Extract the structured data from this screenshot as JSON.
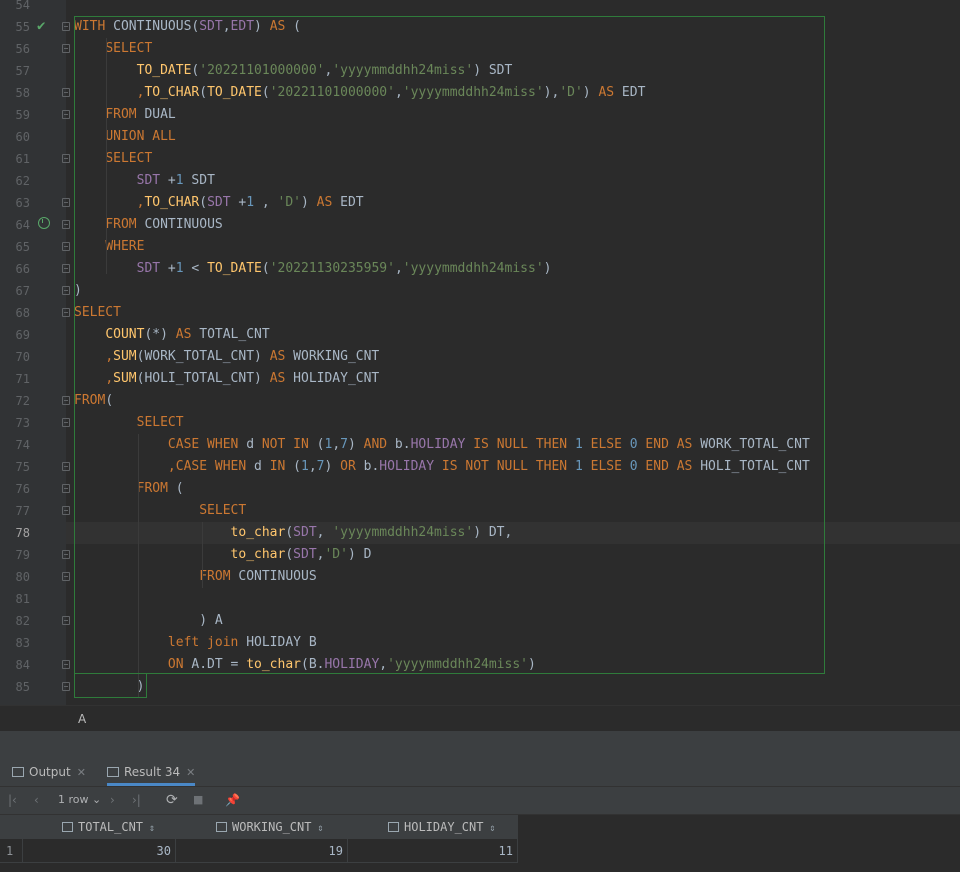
{
  "editor": {
    "current_line": "78",
    "lines": [
      {
        "n": "54",
        "html": ""
      },
      {
        "n": "55",
        "html": "<span class='kw'>WITH</span> CONTINUOUS(<span class='id'>SDT</span>,<span class='id'>EDT</span>) <span class='kw'>AS</span> ("
      },
      {
        "n": "56",
        "html": "    <span class='kw'>SELECT</span>"
      },
      {
        "n": "57",
        "html": "        <span class='fn'>TO_DATE</span>(<span class='str'>'20221101000000'</span>,<span class='str'>'yyyymmddhh24miss'</span>) SDT"
      },
      {
        "n": "58",
        "html": "        <span class='kw'>,</span><span class='fn'>TO_CHAR</span>(<span class='fn'>TO_DATE</span>(<span class='str'>'20221101000000'</span>,<span class='str'>'yyyymmddhh24miss'</span>),<span class='str'>'D'</span>) <span class='kw'>AS</span> EDT"
      },
      {
        "n": "59",
        "html": "    <span class='kw'>FROM</span> DUAL"
      },
      {
        "n": "60",
        "html": "    <span class='kw'>UNION ALL</span>"
      },
      {
        "n": "61",
        "html": "    <span class='kw'>SELECT</span>"
      },
      {
        "n": "62",
        "html": "        <span class='id'>SDT</span> +<span class='num'>1</span> SDT"
      },
      {
        "n": "63",
        "html": "        <span class='kw'>,</span><span class='fn'>TO_CHAR</span>(<span class='id'>SDT</span> +<span class='num'>1</span> , <span class='str'>'D'</span>) <span class='kw'>AS</span> EDT"
      },
      {
        "n": "64",
        "html": "    <span class='kw'>FROM</span> CONTINUOUS"
      },
      {
        "n": "65",
        "html": "    <span class='kw'>WHERE</span>"
      },
      {
        "n": "66",
        "html": "        <span class='id'>SDT</span> +<span class='num'>1</span> &lt; <span class='fn'>TO_DATE</span>(<span class='str'>'20221130235959'</span>,<span class='str'>'yyyymmddhh24miss'</span>)"
      },
      {
        "n": "67",
        "html": ")"
      },
      {
        "n": "68",
        "html": "<span class='kw'>SELECT</span>"
      },
      {
        "n": "69",
        "html": "    <span class='fn'>COUNT</span>(*) <span class='kw'>AS</span> TOTAL_CNT"
      },
      {
        "n": "70",
        "html": "    <span class='kw'>,</span><span class='fn'>SUM</span>(WORK_TOTAL_CNT) <span class='kw'>AS</span> WORKING_CNT"
      },
      {
        "n": "71",
        "html": "    <span class='kw'>,</span><span class='fn'>SUM</span>(HOLI_TOTAL_CNT) <span class='kw'>AS</span> HOLIDAY_CNT"
      },
      {
        "n": "72",
        "html": "<span class='kw'>FROM</span>("
      },
      {
        "n": "73",
        "html": "        <span class='kw'>SELECT</span>"
      },
      {
        "n": "74",
        "html": "            <span class='kw'>CASE WHEN</span> d <span class='kw'>NOT IN</span> (<span class='num'>1</span>,<span class='num'>7</span>) <span class='kw'>AND</span> b.<span class='id'>HOLIDAY</span> <span class='kw'>IS NULL THEN</span> <span class='num'>1</span> <span class='kw'>ELSE</span> <span class='num'>0</span> <span class='kw'>END AS</span> WORK_TOTAL_CNT"
      },
      {
        "n": "75",
        "html": "            <span class='kw'>,CASE WHEN</span> d <span class='kw'>IN</span> (<span class='num'>1</span>,<span class='num'>7</span>) <span class='kw'>OR</span> b.<span class='id'>HOLIDAY</span> <span class='kw'>IS NOT NULL THEN</span> <span class='num'>1</span> <span class='kw'>ELSE</span> <span class='num'>0</span> <span class='kw'>END AS</span> HOLI_TOTAL_CNT"
      },
      {
        "n": "76",
        "html": "        <span class='kw'>FROM</span> ("
      },
      {
        "n": "77",
        "html": "                <span class='kw'>SELECT</span>"
      },
      {
        "n": "78",
        "html": "                    <span class='fn'>to_char</span>(<span class='id'>SDT</span>, <span class='str'>'yyyymmddhh24miss'</span>) DT,"
      },
      {
        "n": "79",
        "html": "                    <span class='fn'>to_char</span>(<span class='id'>SDT</span>,<span class='str'>'D'</span>) D"
      },
      {
        "n": "80",
        "html": "                <span class='kw'>FROM</span> CONTINUOUS"
      },
      {
        "n": "81",
        "html": ""
      },
      {
        "n": "82",
        "html": "                ) A"
      },
      {
        "n": "83",
        "html": "            <span class='kw'>left join</span> HOLIDAY B"
      },
      {
        "n": "84",
        "html": "            <span class='kw'>ON</span> A.DT = <span class='fn'>to_char</span>(B.<span class='id'>HOLIDAY</span>,<span class='str'>'yyyymmddhh24miss'</span>)"
      },
      {
        "n": "85",
        "html": "        )"
      }
    ]
  },
  "breadcrumb": "A",
  "bottom_tabs": [
    {
      "label": "Output",
      "icon": "output-icon"
    },
    {
      "label": "Result 34",
      "icon": "table-icon"
    }
  ],
  "toolbar": {
    "row_count": "1 row"
  },
  "result": {
    "columns": [
      "TOTAL_CNT",
      "WORKING_CNT",
      "HOLIDAY_CNT"
    ],
    "rows": [
      {
        "num": "1",
        "cells": [
          "30",
          "19",
          "11"
        ]
      }
    ]
  },
  "colors": {
    "keyword": "#cc7832",
    "function": "#ffc66d",
    "identifier": "#9876aa",
    "string": "#6a8759",
    "number": "#6897bb",
    "selection_border": "#2f7b3b",
    "tab_underline": "#4a88c7"
  }
}
